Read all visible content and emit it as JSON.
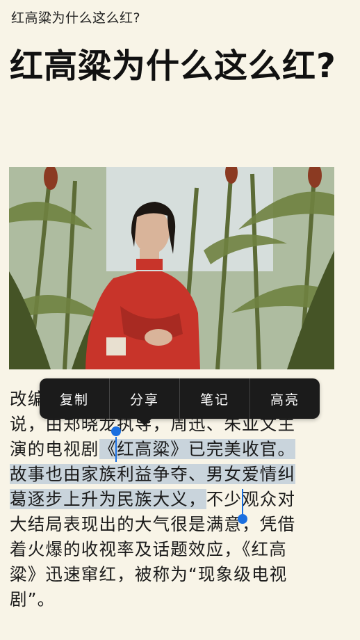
{
  "nav": {
    "title": "红高粱为什么这么红?"
  },
  "article": {
    "headline": "红高粱为什么这么红?",
    "hero_image_alt": "woman in red dress in sorghum field",
    "body_lines": [
      {
        "plain": "改编自莫言同名经典小"
      },
      {
        "plain": "说，由郑晓龙执导，周迅、朱亚文主"
      },
      {
        "pre": "演的电视剧",
        "hl": "《红高粱》已完美收官。"
      },
      {
        "hl": "故事也由家族利益争夺、男女爱情纠"
      },
      {
        "hl": "葛逐步上升为民族大义，",
        "post": "不少观众对"
      },
      {
        "plain": "大结局表现出的大气很是满意，凭借"
      },
      {
        "plain": "着火爆的收视率及话题效应，《红高"
      },
      {
        "plain": "粱》迅速窜红，被称为“现象级电视"
      },
      {
        "plain": "剧”。"
      }
    ]
  },
  "context_menu": {
    "items": [
      "复制",
      "分享",
      "笔记",
      "高亮"
    ]
  },
  "colors": {
    "background": "#f8f4e7",
    "selection": "#c9d4dc",
    "handle": "#1a6fe0",
    "menu_bg": "#1b1b1b"
  }
}
